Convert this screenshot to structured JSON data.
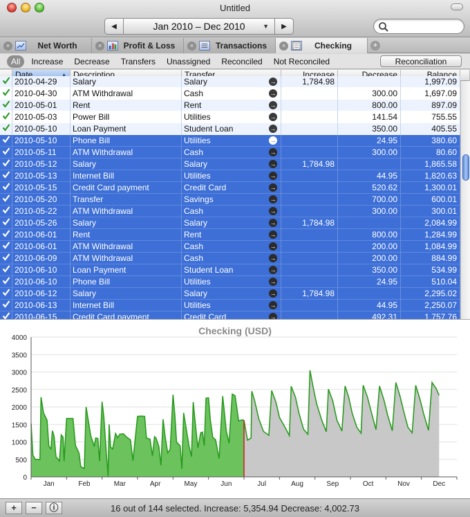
{
  "window": {
    "title": "Untitled"
  },
  "date_range": {
    "label": "Jan 2010 – Dec 2010",
    "prev_icon": "triangle-left-icon",
    "next_icon": "triangle-right-icon"
  },
  "search": {
    "value": "",
    "placeholder": ""
  },
  "tabs": [
    {
      "label": "Net Worth",
      "icon": "chart-icon",
      "active": false
    },
    {
      "label": "Profit & Loss",
      "icon": "bar-chart-icon",
      "active": false
    },
    {
      "label": "Transactions",
      "icon": "list-icon",
      "active": false
    },
    {
      "label": "Checking",
      "icon": "ledger-icon",
      "active": true
    }
  ],
  "filters": [
    "All",
    "Increase",
    "Decrease",
    "Transfers",
    "Unassigned",
    "Reconciled",
    "Not Reconciled"
  ],
  "active_filter": "All",
  "reconciliation_label": "Reconciliation",
  "columns": [
    "Date",
    "Description",
    "Transfer",
    "Increase",
    "Decrease",
    "Balance"
  ],
  "rows": [
    {
      "date": "2010-04-29",
      "desc": "Salary",
      "transfer": "Salary",
      "inc": "1,784.98",
      "dec": "",
      "bal": "1,997.09",
      "sel": false
    },
    {
      "date": "2010-04-30",
      "desc": "ATM Withdrawal",
      "transfer": "Cash",
      "inc": "",
      "dec": "300.00",
      "bal": "1,697.09",
      "sel": false
    },
    {
      "date": "2010-05-01",
      "desc": "Rent",
      "transfer": "Rent",
      "inc": "",
      "dec": "800.00",
      "bal": "897.09",
      "sel": false
    },
    {
      "date": "2010-05-03",
      "desc": "Power Bill",
      "transfer": "Utilities",
      "inc": "",
      "dec": "141.54",
      "bal": "755.55",
      "sel": false
    },
    {
      "date": "2010-05-10",
      "desc": "Loan Payment",
      "transfer": "Student Loan",
      "inc": "",
      "dec": "350.00",
      "bal": "405.55",
      "sel": false
    },
    {
      "date": "2010-05-10",
      "desc": "Phone Bill",
      "transfer": "Utilities",
      "inc": "",
      "dec": "24.95",
      "bal": "380.60",
      "sel": true
    },
    {
      "date": "2010-05-11",
      "desc": "ATM Withdrawal",
      "transfer": "Cash",
      "inc": "",
      "dec": "300.00",
      "bal": "80.60",
      "sel": true
    },
    {
      "date": "2010-05-12",
      "desc": "Salary",
      "transfer": "Salary",
      "inc": "1,784.98",
      "dec": "",
      "bal": "1,865.58",
      "sel": true
    },
    {
      "date": "2010-05-13",
      "desc": "Internet Bill",
      "transfer": "Utilities",
      "inc": "",
      "dec": "44.95",
      "bal": "1,820.63",
      "sel": true
    },
    {
      "date": "2010-05-15",
      "desc": "Credit Card payment",
      "transfer": "Credit Card",
      "inc": "",
      "dec": "520.62",
      "bal": "1,300.01",
      "sel": true
    },
    {
      "date": "2010-05-20",
      "desc": "Transfer",
      "transfer": "Savings",
      "inc": "",
      "dec": "700.00",
      "bal": "600.01",
      "sel": true
    },
    {
      "date": "2010-05-22",
      "desc": "ATM Withdrawal",
      "transfer": "Cash",
      "inc": "",
      "dec": "300.00",
      "bal": "300.01",
      "sel": true
    },
    {
      "date": "2010-05-26",
      "desc": "Salary",
      "transfer": "Salary",
      "inc": "1,784.98",
      "dec": "",
      "bal": "2,084.99",
      "sel": true
    },
    {
      "date": "2010-06-01",
      "desc": "Rent",
      "transfer": "Rent",
      "inc": "",
      "dec": "800.00",
      "bal": "1,284.99",
      "sel": true
    },
    {
      "date": "2010-06-01",
      "desc": "ATM Withdrawal",
      "transfer": "Cash",
      "inc": "",
      "dec": "200.00",
      "bal": "1,084.99",
      "sel": true
    },
    {
      "date": "2010-06-09",
      "desc": "ATM Withdrawal",
      "transfer": "Cash",
      "inc": "",
      "dec": "200.00",
      "bal": "884.99",
      "sel": true
    },
    {
      "date": "2010-06-10",
      "desc": "Loan Payment",
      "transfer": "Student Loan",
      "inc": "",
      "dec": "350.00",
      "bal": "534.99",
      "sel": true
    },
    {
      "date": "2010-06-10",
      "desc": "Phone Bill",
      "transfer": "Utilities",
      "inc": "",
      "dec": "24.95",
      "bal": "510.04",
      "sel": true
    },
    {
      "date": "2010-06-12",
      "desc": "Salary",
      "transfer": "Salary",
      "inc": "1,784.98",
      "dec": "",
      "bal": "2,295.02",
      "sel": true
    },
    {
      "date": "2010-06-13",
      "desc": "Internet Bill",
      "transfer": "Utilities",
      "inc": "",
      "dec": "44.95",
      "bal": "2,250.07",
      "sel": true
    },
    {
      "date": "2010-06-15",
      "desc": "Credit Card payment",
      "transfer": "Credit Card",
      "inc": "",
      "dec": "492.31",
      "bal": "1,757.76",
      "sel": true
    }
  ],
  "status": {
    "text": "16 out of 144 selected. Increase: 5,354.94 Decrease: 4,002.73"
  },
  "colors": {
    "selection": "#3d6fd6",
    "past_fill": "#6cc35e",
    "past_line": "#2a9a1f",
    "future_fill": "#c8c8c8",
    "future_line": "#2a9a1f",
    "today_marker": "#d22222"
  },
  "chart_data": {
    "type": "area",
    "title": "Checking (USD)",
    "ylim": [
      0,
      4000
    ],
    "yticks": [
      0,
      500,
      1000,
      1500,
      2000,
      2500,
      3000,
      3500,
      4000
    ],
    "xlabels": [
      "Jan",
      "Feb",
      "Mar",
      "Apr",
      "May",
      "Jun",
      "Jul",
      "Aug",
      "Sep",
      "Oct",
      "Nov",
      "Dec"
    ],
    "grid": true,
    "today_month_position": 6.0,
    "series_past": [
      [
        0,
        1520
      ],
      [
        0.05,
        620
      ],
      [
        0.12,
        500
      ],
      [
        0.25,
        500
      ],
      [
        0.28,
        2280
      ],
      [
        0.35,
        1830
      ],
      [
        0.45,
        1620
      ],
      [
        0.5,
        880
      ],
      [
        0.56,
        800
      ],
      [
        0.6,
        1320
      ],
      [
        0.65,
        1150
      ],
      [
        0.7,
        580
      ],
      [
        0.8,
        450
      ],
      [
        0.85,
        1200
      ],
      [
        0.9,
        1140
      ],
      [
        0.93,
        450
      ],
      [
        1.0,
        1670
      ],
      [
        1.18,
        1670
      ],
      [
        1.25,
        900
      ],
      [
        1.35,
        680
      ],
      [
        1.4,
        290
      ],
      [
        1.5,
        240
      ],
      [
        1.55,
        2000
      ],
      [
        1.68,
        1180
      ],
      [
        1.78,
        870
      ],
      [
        1.82,
        1110
      ],
      [
        1.88,
        1100
      ],
      [
        1.93,
        450
      ],
      [
        2.0,
        2150
      ],
      [
        2.05,
        1720
      ],
      [
        2.12,
        680
      ],
      [
        2.17,
        20
      ],
      [
        2.2,
        1500
      ],
      [
        2.24,
        850
      ],
      [
        2.3,
        800
      ],
      [
        2.38,
        1240
      ],
      [
        2.44,
        1120
      ],
      [
        2.5,
        1220
      ],
      [
        2.6,
        1230
      ],
      [
        2.7,
        1130
      ],
      [
        2.8,
        1060
      ],
      [
        2.87,
        460
      ],
      [
        3.0,
        1730
      ],
      [
        3.1,
        1740
      ],
      [
        3.2,
        1730
      ],
      [
        3.25,
        1110
      ],
      [
        3.35,
        1080
      ],
      [
        3.42,
        600
      ],
      [
        3.48,
        1150
      ],
      [
        3.52,
        1110
      ],
      [
        3.6,
        870
      ],
      [
        3.66,
        330
      ],
      [
        3.72,
        1650
      ],
      [
        3.78,
        1130
      ],
      [
        3.85,
        690
      ],
      [
        3.92,
        780
      ],
      [
        4.0,
        2350
      ],
      [
        4.05,
        1780
      ],
      [
        4.1,
        990
      ],
      [
        4.2,
        890
      ],
      [
        4.25,
        230
      ],
      [
        4.3,
        1830
      ],
      [
        4.36,
        1450
      ],
      [
        4.45,
        890
      ],
      [
        4.52,
        580
      ],
      [
        4.57,
        2140
      ],
      [
        4.62,
        1600
      ],
      [
        4.7,
        830
      ],
      [
        4.78,
        1260
      ],
      [
        4.83,
        1280
      ],
      [
        4.88,
        890
      ],
      [
        4.93,
        2250
      ],
      [
        5.0,
        2260
      ],
      [
        5.05,
        1640
      ],
      [
        5.12,
        1130
      ],
      [
        5.2,
        1060
      ],
      [
        5.3,
        520
      ],
      [
        5.4,
        2310
      ],
      [
        5.45,
        1820
      ],
      [
        5.5,
        1320
      ],
      [
        5.58,
        960
      ],
      [
        5.67,
        2370
      ],
      [
        5.75,
        2320
      ],
      [
        5.85,
        1600
      ],
      [
        5.95,
        1630
      ],
      [
        6.0,
        1620
      ]
    ],
    "series_future": [
      [
        6.0,
        1620
      ],
      [
        6.1,
        1050
      ],
      [
        6.2,
        1110
      ],
      [
        6.22,
        2450
      ],
      [
        6.3,
        2180
      ],
      [
        6.42,
        1650
      ],
      [
        6.55,
        1300
      ],
      [
        6.7,
        1190
      ],
      [
        6.78,
        2470
      ],
      [
        6.9,
        2140
      ],
      [
        7.0,
        1700
      ],
      [
        7.15,
        1430
      ],
      [
        7.28,
        1180
      ],
      [
        7.33,
        2590
      ],
      [
        7.45,
        2280
      ],
      [
        7.55,
        1820
      ],
      [
        7.68,
        1360
      ],
      [
        7.8,
        1220
      ],
      [
        7.86,
        3050
      ],
      [
        7.95,
        2560
      ],
      [
        8.05,
        2080
      ],
      [
        8.2,
        1600
      ],
      [
        8.32,
        1290
      ],
      [
        8.38,
        2510
      ],
      [
        8.5,
        2180
      ],
      [
        8.62,
        1620
      ],
      [
        8.76,
        1310
      ],
      [
        8.85,
        2600
      ],
      [
        8.95,
        2280
      ],
      [
        9.05,
        1820
      ],
      [
        9.18,
        1420
      ],
      [
        9.3,
        1250
      ],
      [
        9.36,
        2620
      ],
      [
        9.48,
        2280
      ],
      [
        9.6,
        1810
      ],
      [
        9.72,
        1350
      ],
      [
        9.82,
        2600
      ],
      [
        9.95,
        2180
      ],
      [
        10.05,
        1760
      ],
      [
        10.18,
        1320
      ],
      [
        10.28,
        2700
      ],
      [
        10.4,
        2300
      ],
      [
        10.5,
        1880
      ],
      [
        10.62,
        1420
      ],
      [
        10.74,
        1260
      ],
      [
        10.84,
        2620
      ],
      [
        10.96,
        2220
      ],
      [
        11.06,
        1820
      ],
      [
        11.2,
        1330
      ],
      [
        11.3,
        2700
      ],
      [
        11.42,
        2520
      ],
      [
        11.5,
        2330
      ]
    ]
  }
}
